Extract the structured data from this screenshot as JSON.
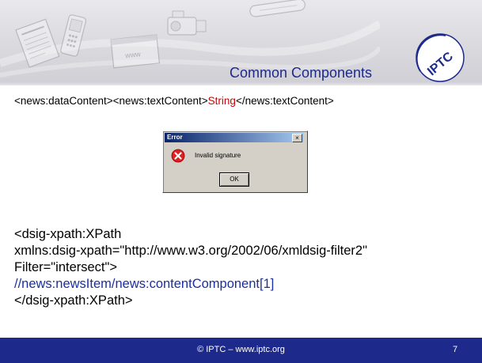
{
  "header": {
    "title": "Common Components",
    "logo_text": "IPTC",
    "www_text": "www"
  },
  "body": {
    "line_top_a": "<news:dataContent><news:textContent>",
    "line_top_string": "String",
    "line_top_b": "</news:textContent>"
  },
  "dialog": {
    "title": "Error",
    "close_label": "×",
    "message": "Invalid signature",
    "ok_label": "OK"
  },
  "xpath": {
    "line1": "<dsig-xpath:XPath",
    "line2": "xmlns:dsig-xpath=\"http://www.w3.org/2002/06/xmldsig-filter2\"",
    "line3": "Filter=\"intersect\">",
    "line4": "//news:newsItem/news:contentComponent[1]",
    "line5": "</dsig-xpath:XPath>"
  },
  "footer": {
    "text": "© IPTC – www.iptc.org",
    "page_number": "7"
  },
  "colors": {
    "brand_blue": "#1d2a8c",
    "string_red": "#d00000",
    "xpath_blue": "#1b2f9e"
  }
}
